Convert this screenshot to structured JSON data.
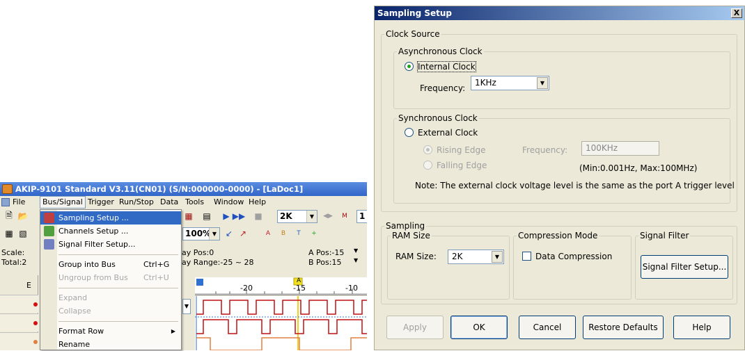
{
  "app": {
    "title": "AKIP-9101 Standard V3.11(CN01) (S/N:000000-0000) - [LaDoc1]",
    "menu": [
      "File",
      "Bus/Signal",
      "Trigger",
      "Run/Stop",
      "Data",
      "Tools",
      "Window",
      "Help"
    ],
    "zoom": "100%",
    "depth_combo": "2K",
    "depth_combo2": "1",
    "scale_label": "Scale:",
    "total_label": "Total:2",
    "delay_pos": "lay Pos:0",
    "delay_range": "lay Range:-25 ~ 28",
    "a_pos": "A Pos:-15",
    "b_pos": "B Pos:15",
    "side_header": "E",
    "ruler_ticks": [
      "-20",
      "-15",
      "-10"
    ],
    "marker_a": "A"
  },
  "menu_dropdown": {
    "items": [
      {
        "label": "Sampling Setup ...",
        "shortcut": "",
        "state": "selected"
      },
      {
        "label": "Channels Setup ...",
        "shortcut": "",
        "state": "normal"
      },
      {
        "label": "Signal Filter Setup...",
        "shortcut": "",
        "state": "normal"
      },
      {
        "label": "Group into Bus",
        "shortcut": "Ctrl+G",
        "state": "normal"
      },
      {
        "label": "Ungroup from Bus",
        "shortcut": "Ctrl+U",
        "state": "disabled"
      },
      {
        "label": "Expand",
        "shortcut": "",
        "state": "disabled"
      },
      {
        "label": "Collapse",
        "shortcut": "",
        "state": "disabled"
      },
      {
        "label": "Format Row",
        "shortcut": "",
        "state": "normal"
      },
      {
        "label": "Rename",
        "shortcut": "",
        "state": "normal"
      }
    ]
  },
  "dialog": {
    "title": "Sampling Setup",
    "close": "X",
    "clock_source": "Clock Source",
    "async_group": "Asynchronous Clock",
    "internal_clock": "Internal Clock",
    "frequency_label": "Frequency:",
    "frequency_value": "1KHz",
    "sync_group": "Synchronous Clock",
    "external_clock": "External Clock",
    "rising_edge": "Rising Edge",
    "falling_edge": "Falling Edge",
    "ext_frequency_label": "Frequency:",
    "ext_frequency_value": "100KHz",
    "range_note": "(Min:0.001Hz, Max:100MHz)",
    "note": "Note: The external clock voltage level is the same as the port A trigger level",
    "sampling_group": "Sampling",
    "ram_group": "RAM Size",
    "ram_label": "RAM Size:",
    "ram_value": "2K",
    "compression_group": "Compression Mode",
    "data_compression": "Data Compression",
    "filter_group": "Signal Filter",
    "filter_button": "Signal Filter Setup...",
    "buttons": {
      "apply": "Apply",
      "ok": "OK",
      "cancel": "Cancel",
      "restore": "Restore Defaults",
      "help": "Help"
    }
  }
}
